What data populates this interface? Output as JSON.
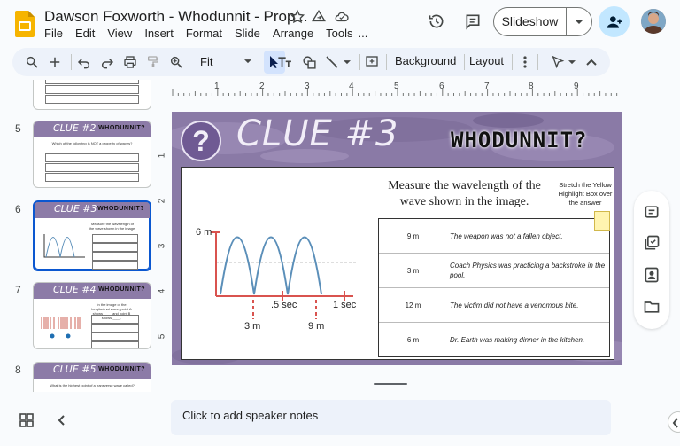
{
  "header": {
    "title": "Dawson Foxworth - Whodunnit - Prop...",
    "menu": [
      "File",
      "Edit",
      "View",
      "Insert",
      "Format",
      "Slide",
      "Arrange",
      "Tools",
      "..."
    ],
    "slideshow_label": "Slideshow"
  },
  "toolbar": {
    "zoom": "Fit",
    "background_label": "Background",
    "layout_label": "Layout"
  },
  "ruler": {
    "marks": [
      "1",
      "2",
      "3",
      "4",
      "5",
      "6",
      "7",
      "8",
      "9"
    ],
    "vmarks": [
      "1",
      "2",
      "3",
      "4",
      "5"
    ]
  },
  "filmstrip": {
    "slides": [
      {
        "num": "5",
        "title": "CLUE #2",
        "heading": "Which of the following is NOT a property of waves?"
      },
      {
        "num": "6",
        "title": "CLUE #3",
        "heading": "Measure the wavelength of the wave shown in the image."
      },
      {
        "num": "7",
        "title": "CLUE #4",
        "heading": "In the image of the longitudinal wave, point A shows ____ and point B shows ____."
      },
      {
        "num": "8",
        "title": "CLUE #5",
        "heading": "What is the highest point of a transverse wave called?"
      }
    ]
  },
  "slide": {
    "clue_title": "CLUE #3",
    "badge": "WHODUNNIT?",
    "question_mark": "?",
    "heading": "Measure the wavelength of the wave shown in the image.",
    "note": "Stretch the Yellow Highlight Box over the answer",
    "graph": {
      "y_label": "6 m",
      "tick_half": ".5 sec",
      "tick_full": "1 sec",
      "mark_a": "3 m",
      "mark_b": "9 m"
    },
    "answers": [
      {
        "value": "9 m",
        "text": "The weapon was not a fallen object."
      },
      {
        "value": "3 m",
        "text": "Coach Physics was practicing a backstroke in the pool."
      },
      {
        "value": "12 m",
        "text": "The victim did not have a venomous bite."
      },
      {
        "value": "6 m",
        "text": "Dr. Earth was making dinner in the kitchen."
      }
    ]
  },
  "notes": {
    "placeholder": "Click to add speaker notes"
  },
  "colors": {
    "accent": "#0b57d0",
    "slide_purple": "#8a7aa6",
    "share_bg": "#c2e7ff",
    "highlight": "#fff4b0",
    "wave": "#5b8fb9",
    "marker": "#d9534f"
  }
}
